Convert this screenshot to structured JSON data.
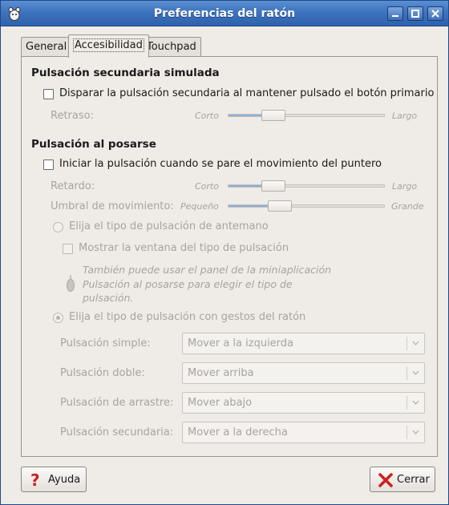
{
  "window": {
    "title": "Preferencias del ratón"
  },
  "tabs": [
    {
      "label": "General"
    },
    {
      "label": "Accesibilidad"
    },
    {
      "label": "Touchpad"
    }
  ],
  "secondary_click": {
    "title": "Pulsación secundaria simulada",
    "checkbox_label": "Disparar la pulsación secundaria al mantener pulsado el botón primario",
    "checked": false,
    "delay_label": "Retraso:",
    "min_label": "Corto",
    "max_label": "Largo",
    "delay_level": 0.25
  },
  "dwell_click": {
    "title": "Pulsación al posarse",
    "checkbox_label": "Iniciar la pulsación cuando se pare el movimiento del puntero",
    "checked": false,
    "delay_label": "Retardo:",
    "delay_min": "Corto",
    "delay_max": "Largo",
    "delay_level": 0.25,
    "threshold_label": "Umbral de movimiento:",
    "threshold_min": "Pequeño",
    "threshold_max": "Grande",
    "threshold_level": 0.3,
    "radio_beforehand": "Elija el tipo de pulsación de antemano",
    "show_window_label": "Mostrar la ventana del tipo de pulsación",
    "hint_line1": "También puede usar el panel de la miniaplicación",
    "hint_line2": "Pulsación al posarse para elegir el tipo de",
    "hint_line3": "pulsación.",
    "radio_gestures": "Elija el tipo de pulsación con gestos del ratón",
    "gestures": [
      {
        "label": "Pulsación simple:",
        "value": "Mover a la izquierda"
      },
      {
        "label": "Pulsación doble:",
        "value": "Mover arriba"
      },
      {
        "label": "Pulsación de arrastre:",
        "value": "Mover abajo"
      },
      {
        "label": "Pulsación secundaria:",
        "value": "Mover a la derecha"
      }
    ]
  },
  "buttons": {
    "help": "Ayuda",
    "close": "Cerrar"
  },
  "colors": {
    "titlebar": "#3e73be",
    "slider_fill": "#8ab0da",
    "close_icon": "#cc1f1f"
  }
}
